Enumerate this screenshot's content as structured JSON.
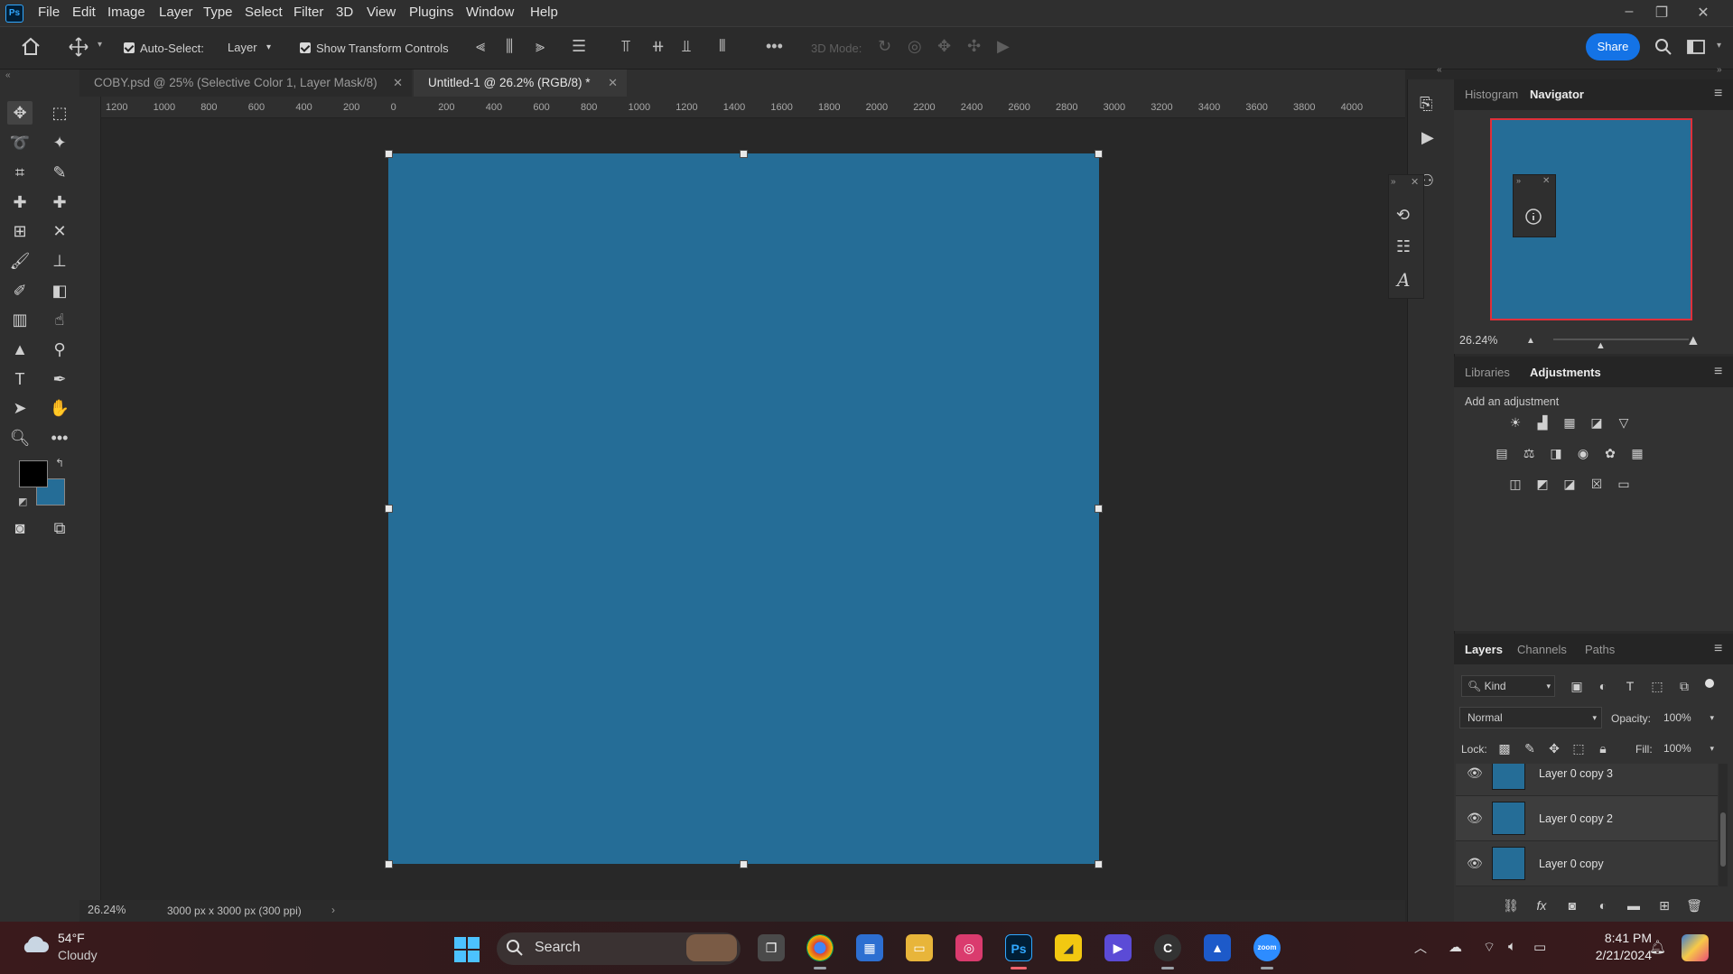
{
  "app": {
    "name": "Photoshop",
    "logo_text": "Ps"
  },
  "menu": [
    "File",
    "Edit",
    "Image",
    "Layer",
    "Type",
    "Select",
    "Filter",
    "3D",
    "View",
    "Plugins",
    "Window",
    "Help"
  ],
  "options_bar": {
    "auto_select_label": "Auto-Select:",
    "auto_select_checked": true,
    "auto_select_target": "Layer",
    "show_transform_label": "Show Transform Controls",
    "show_transform_checked": true,
    "mode_3d_label": "3D Mode:",
    "share_label": "Share"
  },
  "tabs": [
    {
      "label": "COBY.psd @ 25% (Selective Color 1, Layer Mask/8)",
      "active": false
    },
    {
      "label": "Untitled-1 @ 26.2% (RGB/8) *",
      "active": true
    }
  ],
  "ruler_h_labels": [
    "1200",
    "1000",
    "800",
    "600",
    "400",
    "200",
    "0",
    "200",
    "400",
    "600",
    "800",
    "1000",
    "1200",
    "1400",
    "1600",
    "1800",
    "2000",
    "2200",
    "2400",
    "2600",
    "2800",
    "3000",
    "3200",
    "3400",
    "3600",
    "3800",
    "4000"
  ],
  "document": {
    "fill_color": "#256d97"
  },
  "status_bar": {
    "zoom": "26.24%",
    "doc_info": "3000 px x 3000 px (300 ppi)"
  },
  "navigator_panel": {
    "tabs": [
      "Histogram",
      "Navigator"
    ],
    "active_tab": "Navigator",
    "zoom": "26.24%"
  },
  "adjustments_panel": {
    "tabs": [
      "Libraries",
      "Adjustments"
    ],
    "active_tab": "Adjustments",
    "hint": "Add an adjustment"
  },
  "layers_panel": {
    "tabs": [
      "Layers",
      "Channels",
      "Paths"
    ],
    "active_tab": "Layers",
    "filter_kind": "Kind",
    "blend_mode": "Normal",
    "opacity_label": "Opacity:",
    "opacity": "100%",
    "lock_label": "Lock:",
    "fill_label": "Fill:",
    "fill": "100%",
    "layers": [
      {
        "name": "Layer 0 copy 3",
        "visible": true
      },
      {
        "name": "Layer 0 copy 2",
        "visible": true
      },
      {
        "name": "Layer 0 copy",
        "visible": true
      }
    ]
  },
  "taskbar": {
    "weather_temp": "54°F",
    "weather_desc": "Cloudy",
    "search_label": "Search",
    "time": "8:41 PM",
    "date": "2/21/2024"
  }
}
